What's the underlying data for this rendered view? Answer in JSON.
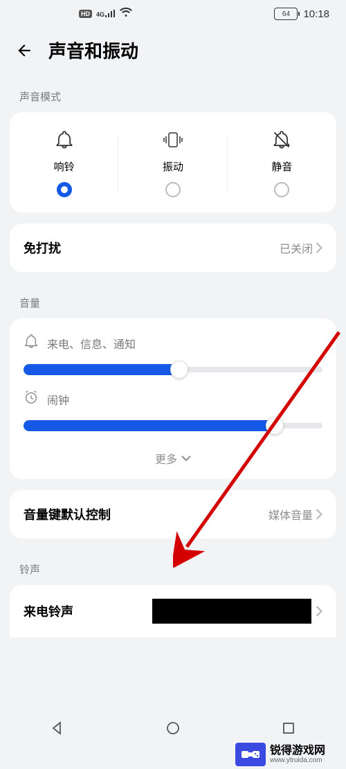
{
  "statusbar": {
    "hd": "HD",
    "net": "4G",
    "battery": "64",
    "time": "10:18"
  },
  "header": {
    "title": "声音和振动"
  },
  "sections": {
    "sound_mode_label": "声音模式",
    "volume_label": "音量",
    "ringtone_label": "铃声"
  },
  "modes": {
    "ring": "响铃",
    "vibrate": "振动",
    "silent": "静音"
  },
  "dnd": {
    "label": "免打扰",
    "value": "已关闭"
  },
  "volume": {
    "call_label": "来电、信息、通知",
    "call_percent": 52,
    "alarm_label": "闹钟",
    "alarm_percent": 84,
    "more": "更多"
  },
  "vol_key": {
    "label": "音量键默认控制",
    "value": "媒体音量"
  },
  "ringtone": {
    "label": "来电铃声"
  },
  "watermark": {
    "cn": "锐得游戏网",
    "en": "www.ytruida.com"
  }
}
